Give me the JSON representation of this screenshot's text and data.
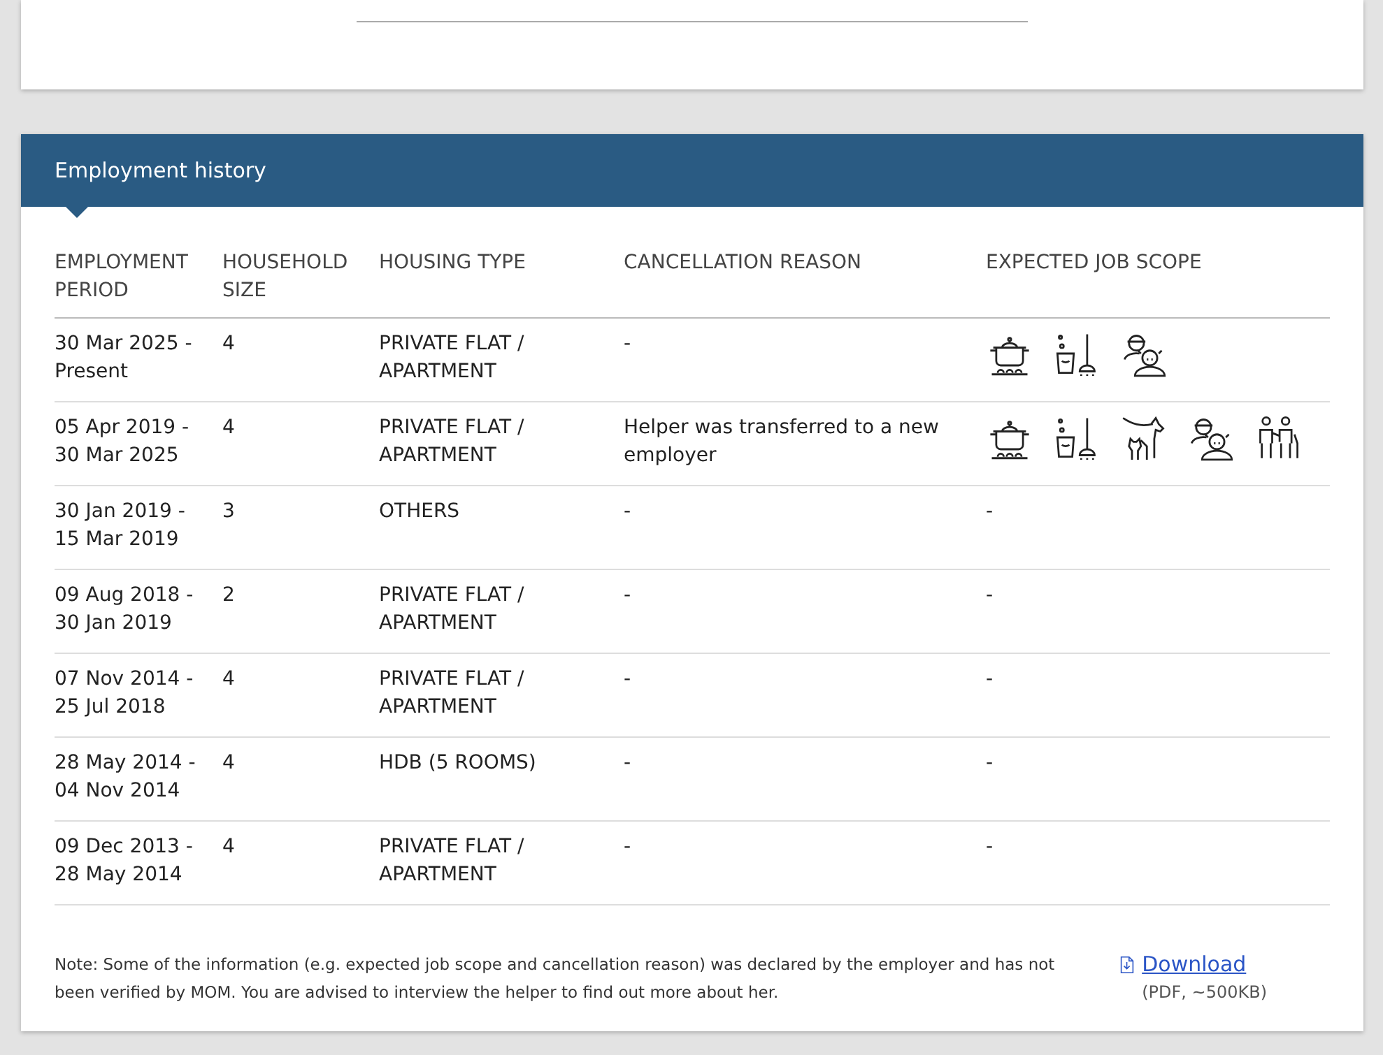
{
  "panel": {
    "title": "Employment history"
  },
  "table": {
    "columns": [
      "EMPLOYMENT PERIOD",
      "HOUSEHOLD SIZE",
      "HOUSING TYPE",
      "CANCELLATION REASON",
      "EXPECTED JOB SCOPE"
    ],
    "rows": [
      {
        "period": "30 Mar 2025 - Present",
        "household_size": "4",
        "housing_type": "PRIVATE FLAT / APARTMENT",
        "cancellation_reason": "-",
        "job_scope": [
          {
            "kind": "cooking"
          },
          {
            "kind": "cleaning"
          },
          {
            "kind": "child_care"
          }
        ]
      },
      {
        "period": "05 Apr 2019 - 30 Mar 2025",
        "household_size": "4",
        "housing_type": "PRIVATE FLAT / APARTMENT",
        "cancellation_reason": "Helper was transferred to a new employer",
        "job_scope": [
          {
            "kind": "cooking"
          },
          {
            "kind": "cleaning"
          },
          {
            "kind": "pet_care"
          },
          {
            "kind": "child_care"
          },
          {
            "kind": "elderly_care"
          }
        ]
      },
      {
        "period": "30 Jan 2019 - 15 Mar 2019",
        "household_size": "3",
        "housing_type": "OTHERS",
        "cancellation_reason": "-",
        "job_scope_text": "-"
      },
      {
        "period": "09 Aug 2018 - 30 Jan 2019",
        "household_size": "2",
        "housing_type": "PRIVATE FLAT / APARTMENT",
        "cancellation_reason": "-",
        "job_scope_text": "-"
      },
      {
        "period": "07 Nov 2014 - 25 Jul 2018",
        "household_size": "4",
        "housing_type": "PRIVATE FLAT / APARTMENT",
        "cancellation_reason": "-",
        "job_scope_text": "-"
      },
      {
        "period": "28 May 2014 - 04 Nov 2014",
        "household_size": "4",
        "housing_type": "HDB (5 ROOMS)",
        "cancellation_reason": "-",
        "job_scope_text": "-"
      },
      {
        "period": "09 Dec 2013 - 28 May 2014",
        "household_size": "4",
        "housing_type": "PRIVATE FLAT / APARTMENT",
        "cancellation_reason": "-",
        "job_scope_text": "-"
      }
    ]
  },
  "note": "Note: Some of the information (e.g. expected job scope and cancellation reason) was declared by the employer and has not been verified by MOM. You are advised to interview the helper to find out more about her.",
  "download": {
    "label": "Download",
    "info": "(PDF, ~500KB)"
  }
}
